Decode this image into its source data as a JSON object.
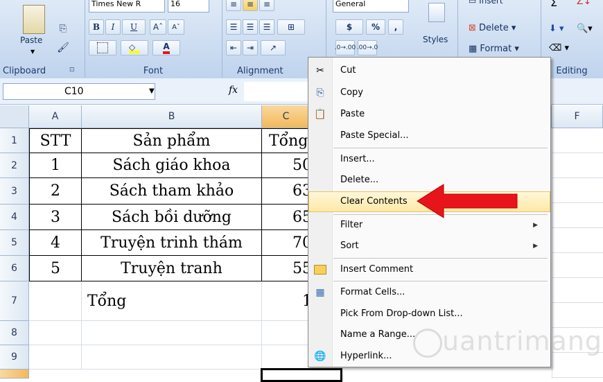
{
  "ribbon": {
    "clipboard": {
      "label": "Clipboard",
      "paste_label": "Paste"
    },
    "font": {
      "label": "Font",
      "font_name": "Times New R",
      "font_size": "16",
      "bold": "B",
      "italic": "I",
      "underline": "U",
      "grow": "Aˆ",
      "shrink": "Aˇ",
      "font_color": "A"
    },
    "alignment": {
      "label": "Alignment"
    },
    "number": {
      "format": "General",
      "currency": "$",
      "percent": "%",
      "comma": ","
    },
    "styles": {
      "label": "Styles"
    },
    "cells": {
      "insert": "Insert",
      "delete": "Delete",
      "format": "Format"
    },
    "editing": {
      "label": "Editing"
    }
  },
  "formula_bar": {
    "name_box": "C10",
    "fx": "fx"
  },
  "columns": [
    "A",
    "B",
    "C",
    "F"
  ],
  "rows": [
    "1",
    "2",
    "3",
    "4",
    "5",
    "6",
    "7",
    "8",
    "9"
  ],
  "table": {
    "header": {
      "stt": "STT",
      "product": "Sản phẩm",
      "total": "Tổng"
    },
    "rows": [
      {
        "stt": "1",
        "product": "Sách giáo khoa",
        "total": "50"
      },
      {
        "stt": "2",
        "product": "Sách tham khảo",
        "total": "63"
      },
      {
        "stt": "3",
        "product": "Sách bồi dưỡng",
        "total": "65"
      },
      {
        "stt": "4",
        "product": "Truyện trinh thám",
        "total": "70"
      },
      {
        "stt": "5",
        "product": "Truyện tranh",
        "total": "55"
      }
    ],
    "total_label": "Tổng",
    "total_value": "1"
  },
  "context_menu": {
    "items": [
      {
        "label": "Cut",
        "icon": "scissors-icon"
      },
      {
        "label": "Copy",
        "icon": "copy-icon"
      },
      {
        "label": "Paste",
        "icon": "paste-icon"
      },
      {
        "label": "Paste Special..."
      },
      {
        "label": "Insert..."
      },
      {
        "label": "Delete..."
      },
      {
        "label": "Clear Contents"
      },
      {
        "label": "Filter",
        "submenu": "▶"
      },
      {
        "label": "Sort",
        "submenu": "▶"
      },
      {
        "label": "Insert Comment",
        "icon": "comment-icon"
      },
      {
        "label": "Format Cells...",
        "icon": "format-cells-icon"
      },
      {
        "label": "Pick From Drop-down List..."
      },
      {
        "label": "Name a Range..."
      },
      {
        "label": "Hyperlink...",
        "icon": "hyperlink-icon"
      }
    ]
  },
  "watermark": "uantrimang",
  "colors": {
    "arrow": "#e8141b",
    "highlight": "#fde9a6",
    "ribbon": "#c9daf0"
  }
}
